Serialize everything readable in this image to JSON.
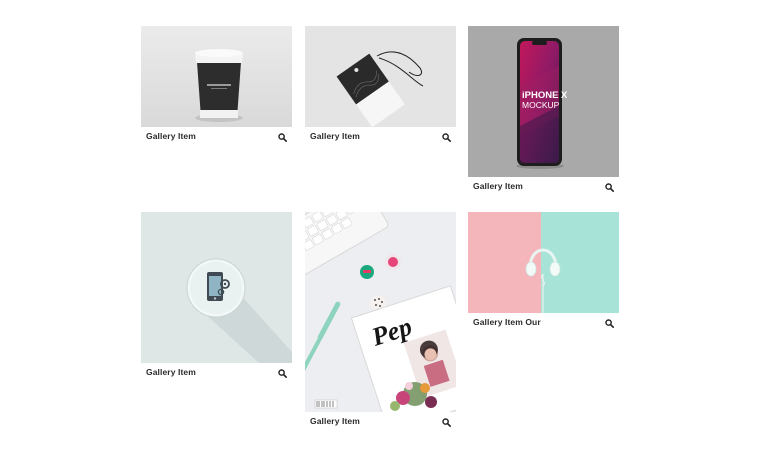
{
  "gallery": {
    "items": [
      {
        "label": "Gallery Item",
        "image": "coffee-cup-mockup",
        "icon": "search-icon"
      },
      {
        "label": "Gallery Item",
        "image": "hang-tag-mockup",
        "icon": "search-icon"
      },
      {
        "label": "Gallery Item",
        "image": "iphone-x-mockup",
        "icon": "search-icon",
        "image_text": [
          "iPHONE X",
          "MOCKUP"
        ]
      },
      {
        "label": "Gallery Item",
        "image": "mobile-settings-icon-graphic",
        "icon": "search-icon"
      },
      {
        "label": "Gallery Item",
        "image": "desk-flatlay-keyboard-magazine",
        "icon": "search-icon",
        "image_text": [
          "Pep"
        ]
      },
      {
        "label": "Gallery Item Our",
        "image": "headphones-pastel",
        "icon": "search-icon"
      }
    ]
  },
  "colors": {
    "caption_text": "#2b2b2b",
    "page_background": "#ffffff"
  }
}
